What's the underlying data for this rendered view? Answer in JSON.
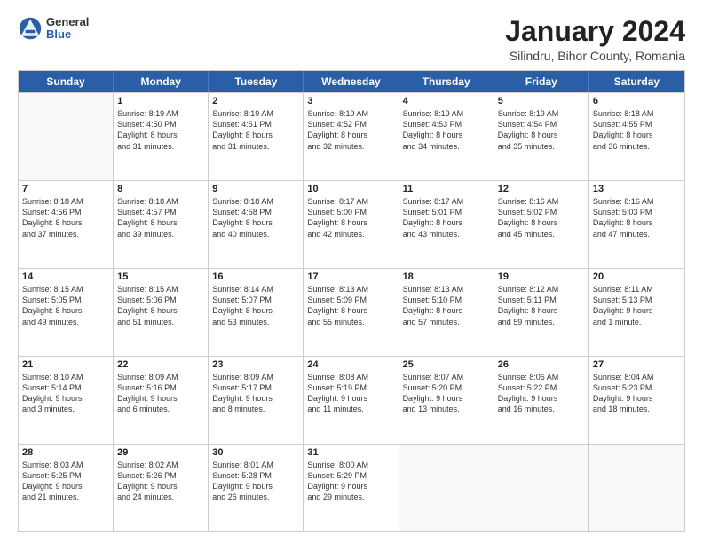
{
  "header": {
    "logo_general": "General",
    "logo_blue": "Blue",
    "title": "January 2024",
    "location": "Silindru, Bihor County, Romania"
  },
  "days": [
    "Sunday",
    "Monday",
    "Tuesday",
    "Wednesday",
    "Thursday",
    "Friday",
    "Saturday"
  ],
  "weeks": [
    [
      {
        "day": "",
        "empty": true
      },
      {
        "day": "1",
        "sunrise": "Sunrise: 8:19 AM",
        "sunset": "Sunset: 4:50 PM",
        "daylight": "Daylight: 8 hours and 31 minutes."
      },
      {
        "day": "2",
        "sunrise": "Sunrise: 8:19 AM",
        "sunset": "Sunset: 4:51 PM",
        "daylight": "Daylight: 8 hours and 31 minutes."
      },
      {
        "day": "3",
        "sunrise": "Sunrise: 8:19 AM",
        "sunset": "Sunset: 4:52 PM",
        "daylight": "Daylight: 8 hours and 32 minutes."
      },
      {
        "day": "4",
        "sunrise": "Sunrise: 8:19 AM",
        "sunset": "Sunset: 4:53 PM",
        "daylight": "Daylight: 8 hours and 34 minutes."
      },
      {
        "day": "5",
        "sunrise": "Sunrise: 8:19 AM",
        "sunset": "Sunset: 4:54 PM",
        "daylight": "Daylight: 8 hours and 35 minutes."
      },
      {
        "day": "6",
        "sunrise": "Sunrise: 8:18 AM",
        "sunset": "Sunset: 4:55 PM",
        "daylight": "Daylight: 8 hours and 36 minutes."
      }
    ],
    [
      {
        "day": "7",
        "sunrise": "Sunrise: 8:18 AM",
        "sunset": "Sunset: 4:56 PM",
        "daylight": "Daylight: 8 hours and 37 minutes."
      },
      {
        "day": "8",
        "sunrise": "Sunrise: 8:18 AM",
        "sunset": "Sunset: 4:57 PM",
        "daylight": "Daylight: 8 hours and 39 minutes."
      },
      {
        "day": "9",
        "sunrise": "Sunrise: 8:18 AM",
        "sunset": "Sunset: 4:58 PM",
        "daylight": "Daylight: 8 hours and 40 minutes."
      },
      {
        "day": "10",
        "sunrise": "Sunrise: 8:17 AM",
        "sunset": "Sunset: 5:00 PM",
        "daylight": "Daylight: 8 hours and 42 minutes."
      },
      {
        "day": "11",
        "sunrise": "Sunrise: 8:17 AM",
        "sunset": "Sunset: 5:01 PM",
        "daylight": "Daylight: 8 hours and 43 minutes."
      },
      {
        "day": "12",
        "sunrise": "Sunrise: 8:16 AM",
        "sunset": "Sunset: 5:02 PM",
        "daylight": "Daylight: 8 hours and 45 minutes."
      },
      {
        "day": "13",
        "sunrise": "Sunrise: 8:16 AM",
        "sunset": "Sunset: 5:03 PM",
        "daylight": "Daylight: 8 hours and 47 minutes."
      }
    ],
    [
      {
        "day": "14",
        "sunrise": "Sunrise: 8:15 AM",
        "sunset": "Sunset: 5:05 PM",
        "daylight": "Daylight: 8 hours and 49 minutes."
      },
      {
        "day": "15",
        "sunrise": "Sunrise: 8:15 AM",
        "sunset": "Sunset: 5:06 PM",
        "daylight": "Daylight: 8 hours and 51 minutes."
      },
      {
        "day": "16",
        "sunrise": "Sunrise: 8:14 AM",
        "sunset": "Sunset: 5:07 PM",
        "daylight": "Daylight: 8 hours and 53 minutes."
      },
      {
        "day": "17",
        "sunrise": "Sunrise: 8:13 AM",
        "sunset": "Sunset: 5:09 PM",
        "daylight": "Daylight: 8 hours and 55 minutes."
      },
      {
        "day": "18",
        "sunrise": "Sunrise: 8:13 AM",
        "sunset": "Sunset: 5:10 PM",
        "daylight": "Daylight: 8 hours and 57 minutes."
      },
      {
        "day": "19",
        "sunrise": "Sunrise: 8:12 AM",
        "sunset": "Sunset: 5:11 PM",
        "daylight": "Daylight: 8 hours and 59 minutes."
      },
      {
        "day": "20",
        "sunrise": "Sunrise: 8:11 AM",
        "sunset": "Sunset: 5:13 PM",
        "daylight": "Daylight: 9 hours and 1 minute."
      }
    ],
    [
      {
        "day": "21",
        "sunrise": "Sunrise: 8:10 AM",
        "sunset": "Sunset: 5:14 PM",
        "daylight": "Daylight: 9 hours and 3 minutes."
      },
      {
        "day": "22",
        "sunrise": "Sunrise: 8:09 AM",
        "sunset": "Sunset: 5:16 PM",
        "daylight": "Daylight: 9 hours and 6 minutes."
      },
      {
        "day": "23",
        "sunrise": "Sunrise: 8:09 AM",
        "sunset": "Sunset: 5:17 PM",
        "daylight": "Daylight: 9 hours and 8 minutes."
      },
      {
        "day": "24",
        "sunrise": "Sunrise: 8:08 AM",
        "sunset": "Sunset: 5:19 PM",
        "daylight": "Daylight: 9 hours and 11 minutes."
      },
      {
        "day": "25",
        "sunrise": "Sunrise: 8:07 AM",
        "sunset": "Sunset: 5:20 PM",
        "daylight": "Daylight: 9 hours and 13 minutes."
      },
      {
        "day": "26",
        "sunrise": "Sunrise: 8:06 AM",
        "sunset": "Sunset: 5:22 PM",
        "daylight": "Daylight: 9 hours and 16 minutes."
      },
      {
        "day": "27",
        "sunrise": "Sunrise: 8:04 AM",
        "sunset": "Sunset: 5:23 PM",
        "daylight": "Daylight: 9 hours and 18 minutes."
      }
    ],
    [
      {
        "day": "28",
        "sunrise": "Sunrise: 8:03 AM",
        "sunset": "Sunset: 5:25 PM",
        "daylight": "Daylight: 9 hours and 21 minutes."
      },
      {
        "day": "29",
        "sunrise": "Sunrise: 8:02 AM",
        "sunset": "Sunset: 5:26 PM",
        "daylight": "Daylight: 9 hours and 24 minutes."
      },
      {
        "day": "30",
        "sunrise": "Sunrise: 8:01 AM",
        "sunset": "Sunset: 5:28 PM",
        "daylight": "Daylight: 9 hours and 26 minutes."
      },
      {
        "day": "31",
        "sunrise": "Sunrise: 8:00 AM",
        "sunset": "Sunset: 5:29 PM",
        "daylight": "Daylight: 9 hours and 29 minutes."
      },
      {
        "day": "",
        "empty": true
      },
      {
        "day": "",
        "empty": true
      },
      {
        "day": "",
        "empty": true
      }
    ]
  ]
}
